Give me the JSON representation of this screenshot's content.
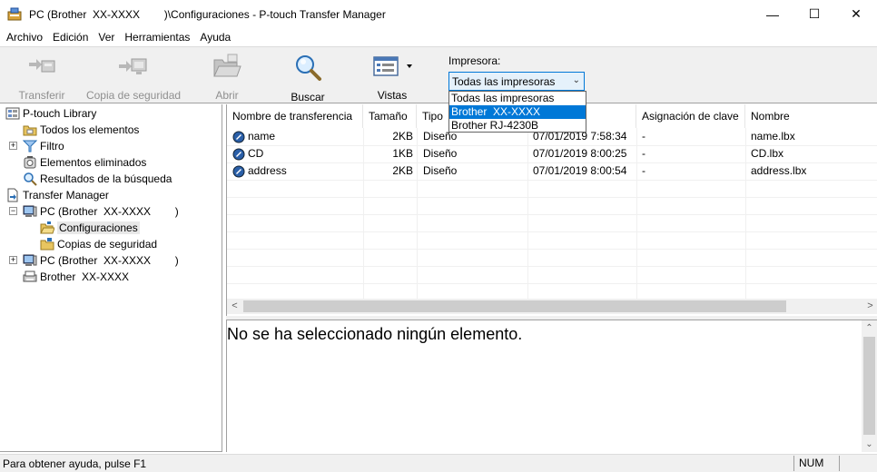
{
  "window": {
    "title": "PC (Brother  XX-XXXX        )\\Configuraciones - P-touch Transfer Manager",
    "minimize": "—",
    "maximize": "☐",
    "close": "✕"
  },
  "menu": {
    "items": [
      {
        "label": "Archivo"
      },
      {
        "label": "Edición"
      },
      {
        "label": "Ver"
      },
      {
        "label": "Herramientas"
      },
      {
        "label": "Ayuda"
      }
    ]
  },
  "toolbar": {
    "transfer": "Transferir",
    "backup": "Copia de seguridad",
    "open": "Abrir",
    "search": "Buscar",
    "views": "Vistas",
    "printer_label": "Impresora:",
    "printer_value": "Todas las impresoras",
    "printer_options": [
      "Todas las impresoras",
      "Brother  XX-XXXX",
      "Brother RJ-4230B"
    ],
    "printer_selected_option": "Brother  XX-XXXX"
  },
  "tree": {
    "library": "P-touch Library",
    "all_items": "Todos los elementos",
    "filter": "Filtro",
    "deleted": "Elementos eliminados",
    "search_results": "Resultados de la búsqueda",
    "transfer_manager": "Transfer Manager",
    "pc1": "PC (Brother  XX-XXXX        )",
    "configurations": "Configuraciones",
    "backups": "Copias de seguridad",
    "pc2": "PC (Brother  XX-XXXX        )",
    "brother": "Brother  XX-XXXX"
  },
  "table": {
    "headers": {
      "name": "Nombre de transferencia",
      "size": "Tamaño",
      "type": "Tipo",
      "date": "",
      "key": "Asignación de clave",
      "filename": "Nombre"
    },
    "rows": [
      {
        "name": "name",
        "size": "2KB",
        "type": "Diseño",
        "date": "07/01/2019 7:58:34",
        "key": "-",
        "filename": "name.lbx"
      },
      {
        "name": "CD",
        "size": "1KB",
        "type": "Diseño",
        "date": "07/01/2019 8:00:25",
        "key": "-",
        "filename": "CD.lbx"
      },
      {
        "name": "address",
        "size": "2KB",
        "type": "Diseño",
        "date": "07/01/2019 8:00:54",
        "key": "-",
        "filename": "address.lbx"
      }
    ]
  },
  "preview": {
    "message": "No se ha seleccionado ningún elemento."
  },
  "status": {
    "help": "Para obtener ayuda, pulse F1",
    "num": "NUM"
  },
  "colors": {
    "accent": "#0078d7",
    "toolbar_bg": "#f0f0f0"
  }
}
